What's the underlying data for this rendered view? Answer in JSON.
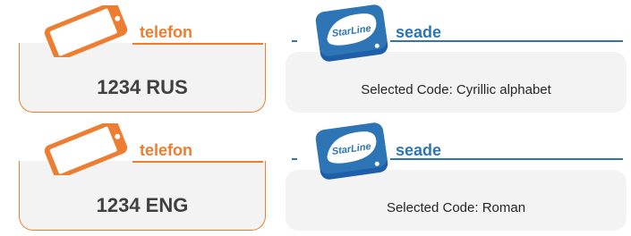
{
  "colors": {
    "phone_accent": "#ed7d31",
    "device_accent": "#2e75b6",
    "box_fill": "#f3f3f3",
    "value_text": "#404040"
  },
  "rows": [
    {
      "phone": {
        "icon": "smartphone-icon",
        "label": "telefon",
        "value": "1234 RUS"
      },
      "device": {
        "icon": "starline-device-icon",
        "logo_text": "StarLine",
        "label": "seade",
        "value": "Selected Code: Cyrillic alphabet"
      }
    },
    {
      "phone": {
        "icon": "smartphone-icon",
        "label": "telefon",
        "value": "1234 ENG"
      },
      "device": {
        "icon": "starline-device-icon",
        "logo_text": "StarLine",
        "label": "seade",
        "value": "Selected Code: Roman"
      }
    }
  ]
}
